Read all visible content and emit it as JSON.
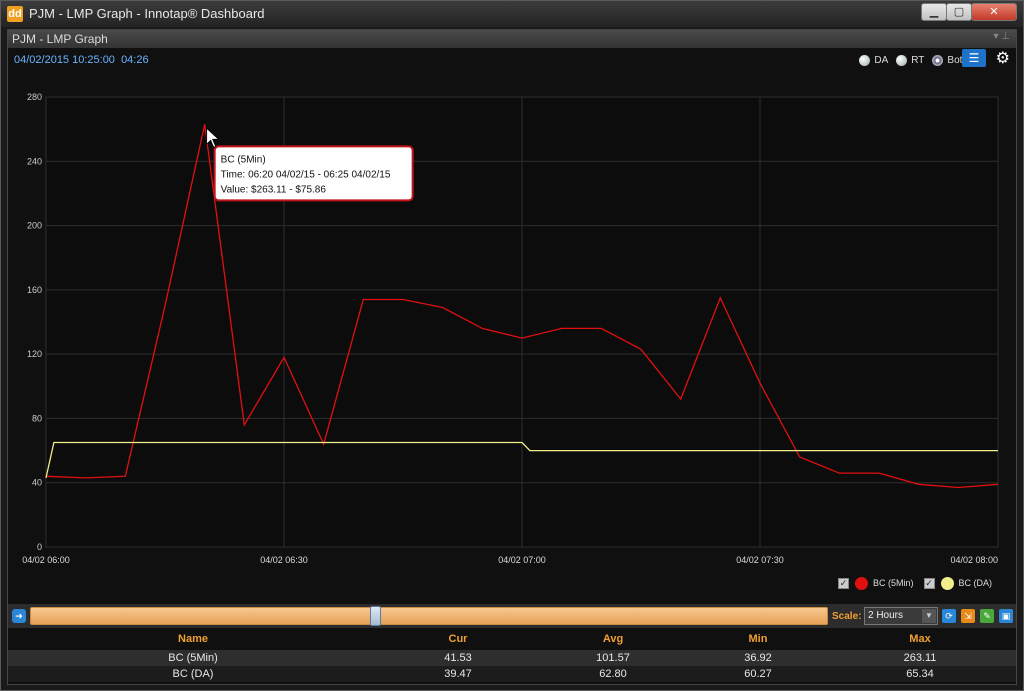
{
  "window": {
    "title": "PJM - LMP Graph - Innotap® Dashboard",
    "icon": "innotap-app-icon",
    "icon_glyph": "dd"
  },
  "window_controls": {
    "minimize": "▁",
    "maximize": "▢",
    "close": "✕"
  },
  "panel": {
    "title": "PJM - LMP Graph",
    "controls": "▾ ⊥"
  },
  "header": {
    "timestamp": "04/02/2015 10:25:00",
    "countdown": "04:26",
    "modes": [
      {
        "label": "DA",
        "selected": false
      },
      {
        "label": "RT",
        "selected": false
      },
      {
        "label": "Both",
        "selected": true
      }
    ],
    "list_icon": "list-icon",
    "settings_icon": "gear-icon"
  },
  "chart_data": {
    "type": "line",
    "x_ticks": [
      "04/02 06:00",
      "04/02 06:30",
      "04/02 07:00",
      "04/02 07:30",
      "04/02 08:00"
    ],
    "x_range_minutes": [
      0,
      120
    ],
    "ylim": [
      0,
      280
    ],
    "y_ticks": [
      0,
      40,
      80,
      120,
      160,
      200,
      240,
      280
    ],
    "grid": true,
    "series": [
      {
        "name": "BC (5Min)",
        "color": "#e01010",
        "points": [
          [
            0,
            44
          ],
          [
            5,
            43
          ],
          [
            10,
            44
          ],
          [
            15,
            150
          ],
          [
            20,
            263
          ],
          [
            25,
            76
          ],
          [
            30,
            118
          ],
          [
            35,
            64
          ],
          [
            40,
            154
          ],
          [
            45,
            154
          ],
          [
            50,
            149
          ],
          [
            55,
            136
          ],
          [
            60,
            130
          ],
          [
            65,
            136
          ],
          [
            70,
            136
          ],
          [
            75,
            123
          ],
          [
            80,
            92
          ],
          [
            85,
            155
          ],
          [
            90,
            102
          ],
          [
            95,
            56
          ],
          [
            100,
            46
          ],
          [
            105,
            46
          ],
          [
            110,
            39
          ],
          [
            115,
            37
          ],
          [
            120,
            39
          ]
        ]
      },
      {
        "name": "BC (DA)",
        "color": "#f2ee8a",
        "points": [
          [
            0,
            43
          ],
          [
            1,
            65
          ],
          [
            60,
            65
          ],
          [
            61,
            60
          ],
          [
            120,
            60
          ]
        ]
      }
    ],
    "tooltip": {
      "series": "BC (5Min)",
      "time": "Time: 06:20 04/02/15 - 06:25 04/02/15",
      "value": "Value: $263.11 - $75.86",
      "at": [
        20,
        263
      ]
    },
    "legend": "bottom-right"
  },
  "legend": [
    {
      "label": "BC (5Min)",
      "color": "#e01010",
      "checked": true
    },
    {
      "label": "BC (DA)",
      "color": "#f2ee8a",
      "checked": true
    }
  ],
  "scroller": {
    "left_icon": "arrow-right-icon",
    "scale_label": "Scale:",
    "scale_value": "2 Hours",
    "tool_icons": [
      "refresh-icon",
      "export-icon",
      "edit-icon",
      "save-icon"
    ]
  },
  "stats": {
    "headers": [
      "Name",
      "Cur",
      "Avg",
      "Min",
      "Max"
    ],
    "rows": [
      [
        "BC (5Min)",
        "41.53",
        "101.57",
        "36.92",
        "263.11"
      ],
      [
        "BC (DA)",
        "39.47",
        "62.80",
        "60.27",
        "65.34"
      ]
    ]
  }
}
